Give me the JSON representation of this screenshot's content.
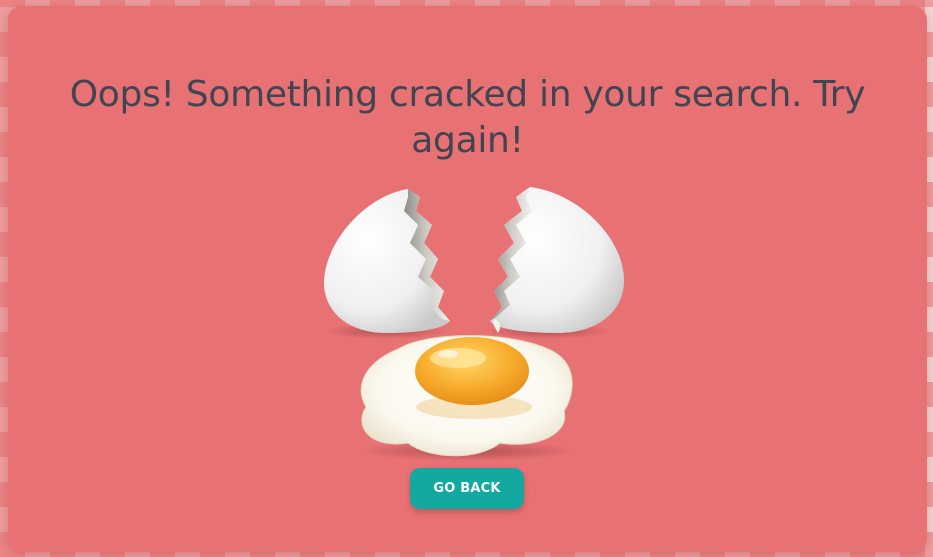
{
  "message": {
    "headline": "Oops! Something cracked in your search. Try again!"
  },
  "illustration": {
    "icon": "cracked-egg-icon"
  },
  "actions": {
    "go_back_label": "GO BACK"
  },
  "colors": {
    "card_background": "#e87174",
    "headline_text": "#3f4551",
    "button_background": "#13a8a0",
    "button_text": "#ffffff",
    "checker_light": "#f4d3d3",
    "egg_yolk": "#f6a72b"
  }
}
